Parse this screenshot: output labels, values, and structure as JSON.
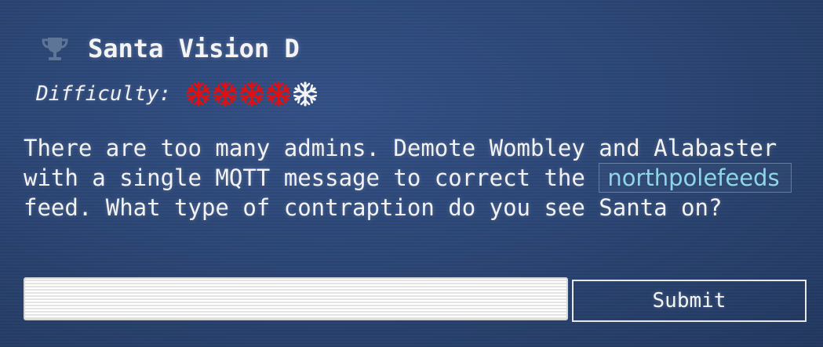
{
  "objective": {
    "icon": "trophy-icon",
    "title": "Santa Vision D",
    "difficulty_label": "Difficulty:",
    "difficulty": {
      "level": 4,
      "max": 5,
      "active_color": "#e01010",
      "inactive_color": "#f4f4f4",
      "icon": "snowflake-icon"
    },
    "question_parts": {
      "before_code": "There are too many admins. Demote Wombley and Alabaster with a single MQTT message to correct the",
      "code": "northpolefeeds",
      "after_code": "feed. What type of contraption do you see Santa on?"
    }
  },
  "answer": {
    "value": "",
    "placeholder": ""
  },
  "submit_label": "Submit"
}
